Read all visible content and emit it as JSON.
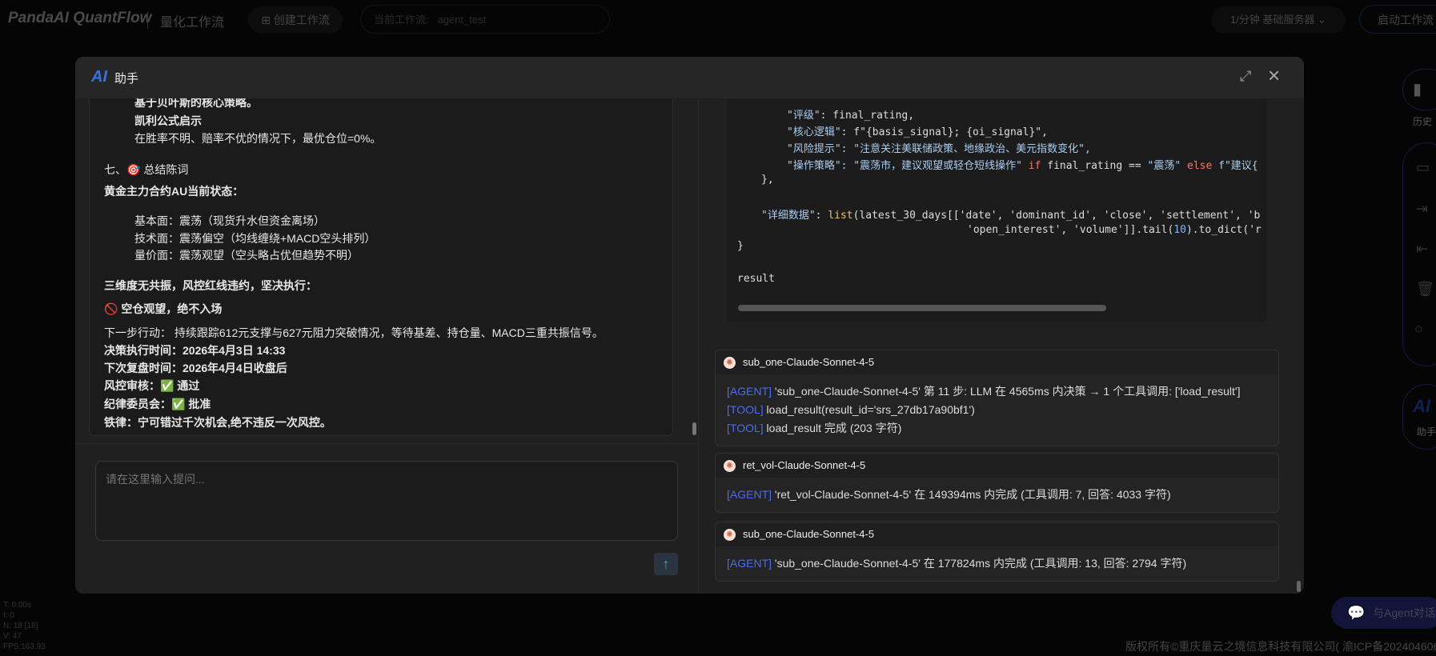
{
  "topbar": {
    "logo": "PandaAI QuantFlow",
    "subtitle": "量化工作流",
    "create_button": "⊞ 创建工作流",
    "current_label": "当前工作流:",
    "current_value": "agent_test",
    "server": "1/分钟  基础服务器 ⌄",
    "start_button": "启动工作流"
  },
  "sidebar": {
    "history_label": "历史",
    "assistant_label": "助手",
    "assistant_logo": "AI",
    "icons": [
      "bar-chart-icon",
      "save-icon",
      "export-icon",
      "import-icon",
      "trash-icon",
      "circle-icon"
    ]
  },
  "stats": [
    "T: 0.00s",
    "I: 0",
    "N: 18 [18]",
    "V: 47",
    "FPS:163.93"
  ],
  "footer": "版权所有©重庆量云之境信息科技有限公司( 渝ICP备2024046064号",
  "agent_chat_button": "与Agent对话",
  "modal": {
    "logo": "AI",
    "title": "助手",
    "chat_lines": [
      {
        "text": "基于贝叶斯的核心策略。",
        "bold": true,
        "indent": true
      },
      {
        "text": "凯利公式启示",
        "bold": true,
        "indent": true
      },
      {
        "text": "在胜率不明、赔率不优的情况下，最优仓位=0%。",
        "bold": false,
        "indent": true
      },
      {
        "text": "七、🎯 总结陈词",
        "bold": false,
        "indent": false
      },
      {
        "text": "黄金主力合约AU当前状态：",
        "bold": true,
        "indent": false
      },
      {
        "text": "基本面：震荡（现货升水但资金离场）",
        "bold": false,
        "indent": true
      },
      {
        "text": "技术面：震荡偏空（均线缠绕+MACD空头排列）",
        "bold": false,
        "indent": true
      },
      {
        "text": "量价面：震荡观望（空头略占优但趋势不明）",
        "bold": false,
        "indent": true
      },
      {
        "text": "三维度无共振，风控红线违约，坚决执行：",
        "bold": true,
        "indent": false
      },
      {
        "text": "🚫 空仓观望，绝不入场",
        "bold": true,
        "indent": false
      },
      {
        "text": "下一步行动： 持续跟踪612元支撑与627元阻力突破情况，等待基差、持仓量、MACD三重共振信号。",
        "bold": false,
        "indent": false
      },
      {
        "text": "决策执行时间：2026年4月3日 14:33",
        "bold": true,
        "indent": false
      },
      {
        "text": "下次复盘时间：2026年4月4日收盘后",
        "bold": true,
        "indent": false
      },
      {
        "text": "风控审核：✅ 通过",
        "bold": true,
        "indent": false
      },
      {
        "text": "纪律委员会：✅ 批准",
        "bold": true,
        "indent": false
      },
      {
        "text": "铁律：宁可错过千次机会,绝不违反一次风控。",
        "bold": true,
        "indent": false
      }
    ],
    "input_placeholder": "请在这里输入提问...",
    "send_icon": "arrow-up-icon",
    "code": {
      "l1_key": "\"评级\"",
      "l1_rest": ": final_rating,",
      "l2_key": "\"核心逻辑\"",
      "l2_rest": ": f\"{basis_signal}; {oi_signal}\",",
      "l3_key": "\"风险提示\"",
      "l3_val": ": \"注意关注美联储政策、地缘政治、美元指数变化\",",
      "l4_key": "\"操作策略\"",
      "l4_val": ": \"震荡市，建议观望或轻仓短线操作\"",
      "l4_if": " if",
      "l4_mid": " final_rating == ",
      "l4_str": "\"震荡\"",
      "l4_else": " else",
      "l4_end": " f\"建议{",
      "l5": "},",
      "l6_key": "\"详细数据\"",
      "l6_colon": ": ",
      "l6_fn": "list",
      "l6_rest": "(latest_30_days[['date', 'dominant_id', 'close', 'settlement', 'b",
      "l7_a": "'open_interest', 'volume']].tail(",
      "l7_num": "10",
      "l7_b": ").to_dict('r",
      "l8": "}",
      "l9": "result"
    },
    "cards": [
      {
        "name": "sub_one-Claude-Sonnet-4-5",
        "lines": [
          {
            "tag": "[AGENT]",
            "text": " 'sub_one-Claude-Sonnet-4-5' 第 11 步: LLM 在 4565ms 内决策 → 1 个工具调用: ['load_result']"
          },
          {
            "tag": "[TOOL]",
            "text": " load_result(result_id='srs_27db17a90bf1')"
          },
          {
            "tag": "[TOOL]",
            "text": " load_result 完成 (203 字符)"
          }
        ]
      },
      {
        "name": "ret_vol-Claude-Sonnet-4-5",
        "lines": [
          {
            "tag": "[AGENT]",
            "text": " 'ret_vol-Claude-Sonnet-4-5' 在 149394ms 内完成 (工具调用: 7, 回答: 4033 字符)"
          }
        ]
      },
      {
        "name": "sub_one-Claude-Sonnet-4-5",
        "lines": [
          {
            "tag": "[AGENT]",
            "text": " 'sub_one-Claude-Sonnet-4-5' 在 177824ms 内完成 (工具调用: 13, 回答: 2794 字符)"
          }
        ]
      }
    ]
  },
  "colors": {
    "accent": "#3b6fe0",
    "tag": "#4a6cf0",
    "keyword": "#f07a6a",
    "string": "#a9cdf0"
  }
}
